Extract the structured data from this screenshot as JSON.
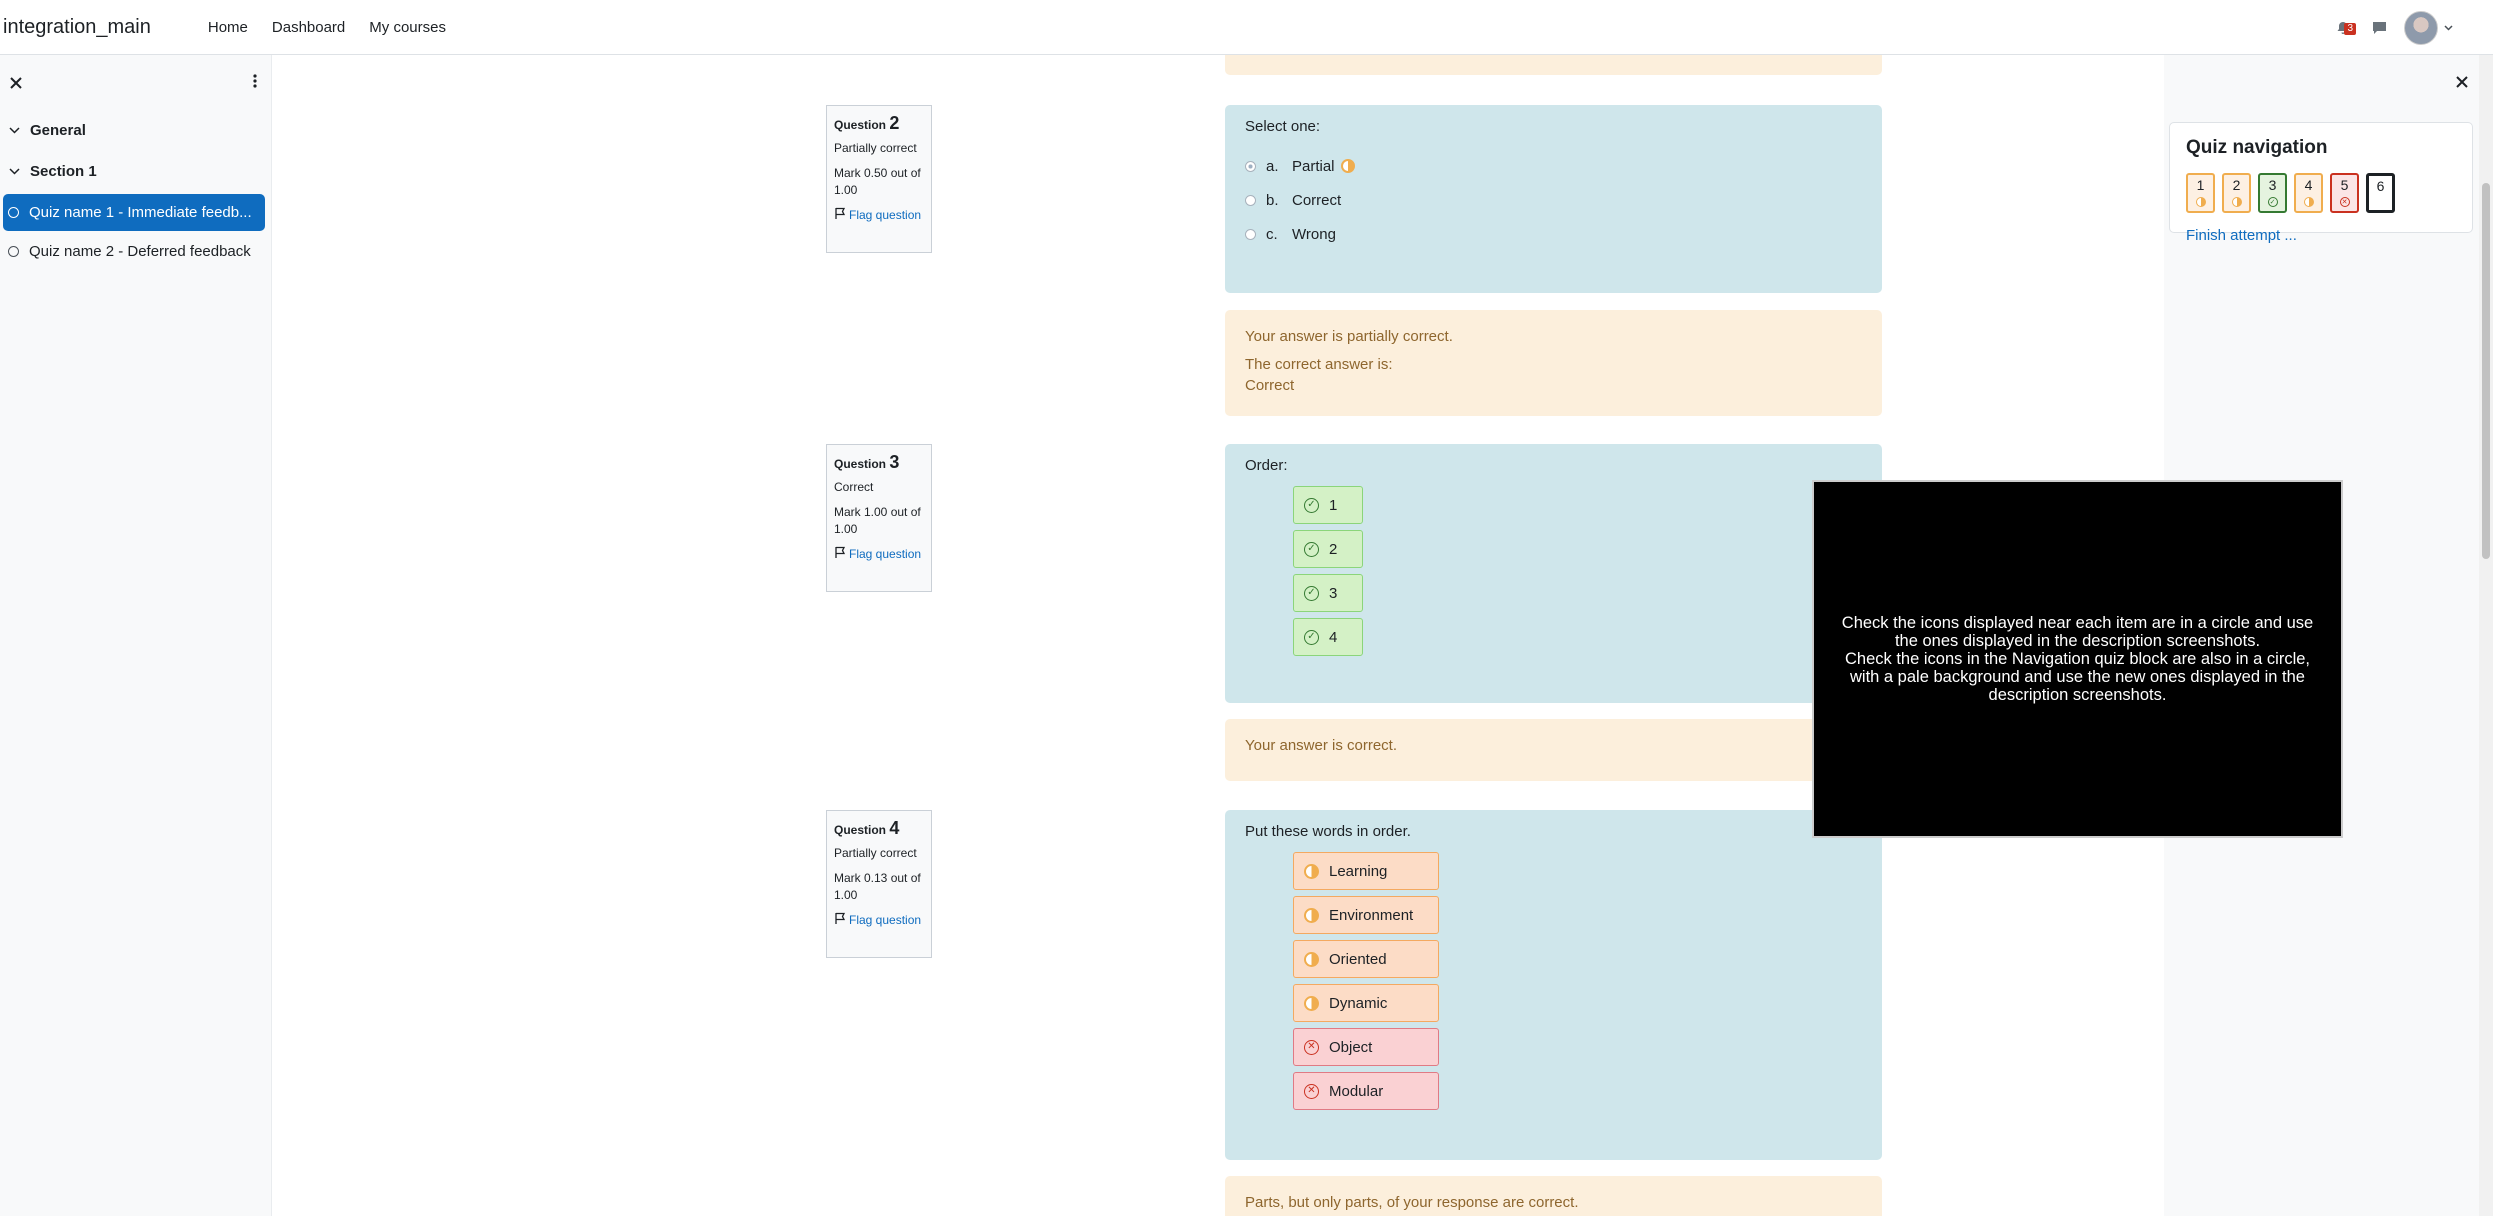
{
  "navbar": {
    "brand": "integration_main",
    "links": [
      "Home",
      "Dashboard",
      "My courses"
    ],
    "notification_count": "3"
  },
  "course_index": {
    "sections": [
      "General",
      "Section 1"
    ],
    "activities": [
      {
        "label": "Quiz name 1 - Immediate feedb...",
        "active": true
      },
      {
        "label": "Quiz name 2 - Deferred feedback",
        "active": false
      }
    ]
  },
  "questions": [
    {
      "prefix": "Question",
      "number": "2",
      "state": "Partially correct",
      "mark": "Mark 0.50 out of 1.00",
      "flag": "Flag question",
      "prompt": "Select one:",
      "options": [
        {
          "letter": "a.",
          "text": "Partial"
        },
        {
          "letter": "b.",
          "text": "Correct"
        },
        {
          "letter": "c.",
          "text": "Wrong"
        }
      ],
      "feedback": [
        "Your answer is partially correct.",
        "The correct answer is:",
        "Correct"
      ]
    },
    {
      "prefix": "Question",
      "number": "3",
      "state": "Correct",
      "mark": "Mark 1.00 out of 1.00",
      "flag": "Flag question",
      "prompt": "Order:",
      "items": [
        "1",
        "2",
        "3",
        "4"
      ],
      "feedback": [
        "Your answer is correct."
      ]
    },
    {
      "prefix": "Question",
      "number": "4",
      "state": "Partially correct",
      "mark": "Mark 0.13 out of 1.00",
      "flag": "Flag question",
      "prompt": "Put these words in order.",
      "items": [
        {
          "text": "Learning",
          "status": "partial"
        },
        {
          "text": "Environment",
          "status": "partial"
        },
        {
          "text": "Oriented",
          "status": "partial"
        },
        {
          "text": "Dynamic",
          "status": "partial"
        },
        {
          "text": "Object",
          "status": "incorrect"
        },
        {
          "text": "Modular",
          "status": "incorrect"
        }
      ],
      "feedback": [
        "Parts, but only parts, of your response are correct."
      ]
    }
  ],
  "quiz_navigation": {
    "title": "Quiz navigation",
    "buttons": [
      {
        "label": "1",
        "status": "partial"
      },
      {
        "label": "2",
        "status": "partial"
      },
      {
        "label": "3",
        "status": "correct"
      },
      {
        "label": "4",
        "status": "partial"
      },
      {
        "label": "5",
        "status": "incorrect"
      },
      {
        "label": "6",
        "status": "current"
      }
    ],
    "finish": "Finish attempt ..."
  },
  "overlay": {
    "line1": "Check the icons displayed near each item are in a circle and use the ones displayed in the description screenshots.",
    "line2": "Check the icons in the Navigation quiz block are also in a circle, with a pale background and use the new ones displayed in the description screenshots."
  },
  "colors": {
    "primary": "#0f6cbf",
    "partial": "#f0ad4e",
    "correct": "#357a32",
    "incorrect": "#ca3120"
  }
}
